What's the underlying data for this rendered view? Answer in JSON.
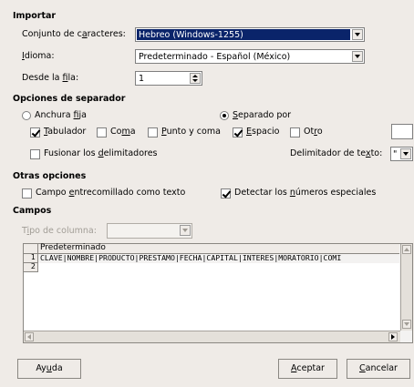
{
  "import": {
    "heading": "Importar",
    "charset": {
      "label_pre": "Conjunto de c",
      "label_u": "a",
      "label_post": "racteres:",
      "value": "Hebreo (Windows-1255)"
    },
    "language": {
      "label_pre": "",
      "label_u": "I",
      "label_post": "dioma:",
      "value": "Predeterminado - Español (México)"
    },
    "from_row": {
      "label_pre": "Desde la ",
      "label_u": "f",
      "label_post": "ila:",
      "value": "1"
    }
  },
  "separator": {
    "heading": "Opciones de separador",
    "fixed_width": {
      "pre": "Anchura ",
      "u": "f",
      "post": "ija",
      "selected": false
    },
    "separated_by": {
      "pre": "",
      "u": "S",
      "post": "eparado por",
      "selected": true
    },
    "tab": {
      "pre": "",
      "u": "T",
      "post": "abulador",
      "checked": true
    },
    "comma": {
      "pre": "Co",
      "u": "m",
      "post": "a",
      "checked": false
    },
    "semicolon": {
      "pre": "",
      "u": "P",
      "post": "unto y coma",
      "checked": false
    },
    "space": {
      "pre": "",
      "u": "E",
      "post": "spacio",
      "checked": true
    },
    "other": {
      "pre": "Ot",
      "u": "r",
      "post": "o",
      "checked": false
    },
    "merge": {
      "pre": "Fusionar los ",
      "u": "d",
      "post": "elimitadores",
      "checked": false
    },
    "text_delim": {
      "pre": "Delimitador de te",
      "u": "x",
      "post": "to:",
      "value": "\""
    }
  },
  "other_options": {
    "heading": "Otras opciones",
    "quoted": {
      "pre": "Campo ",
      "u": "e",
      "post": "ntrecomillado como texto",
      "checked": false
    },
    "special_numbers": {
      "pre": "Detectar los ",
      "u": "n",
      "post": "úmeros especiales",
      "checked": true
    }
  },
  "fields": {
    "heading": "Campos",
    "column_type": {
      "pre": "T",
      "u": "i",
      "post": "po de columna:",
      "value": ""
    },
    "preview": {
      "column_header": "Predeterminado",
      "rows": [
        {
          "num": "1",
          "text": "CLAVE|NOMBRE|PRODUCTO|PRESTAMO|FECHA|CAPITAL|INTERES|MORATORIO|COMI"
        },
        {
          "num": "2",
          "text": ""
        }
      ]
    }
  },
  "buttons": {
    "help": {
      "pre": "Ay",
      "u": "u",
      "post": "da"
    },
    "accept": {
      "pre": "",
      "u": "A",
      "post": "ceptar"
    },
    "cancel": {
      "pre": "",
      "u": "C",
      "post": "ancelar"
    }
  }
}
